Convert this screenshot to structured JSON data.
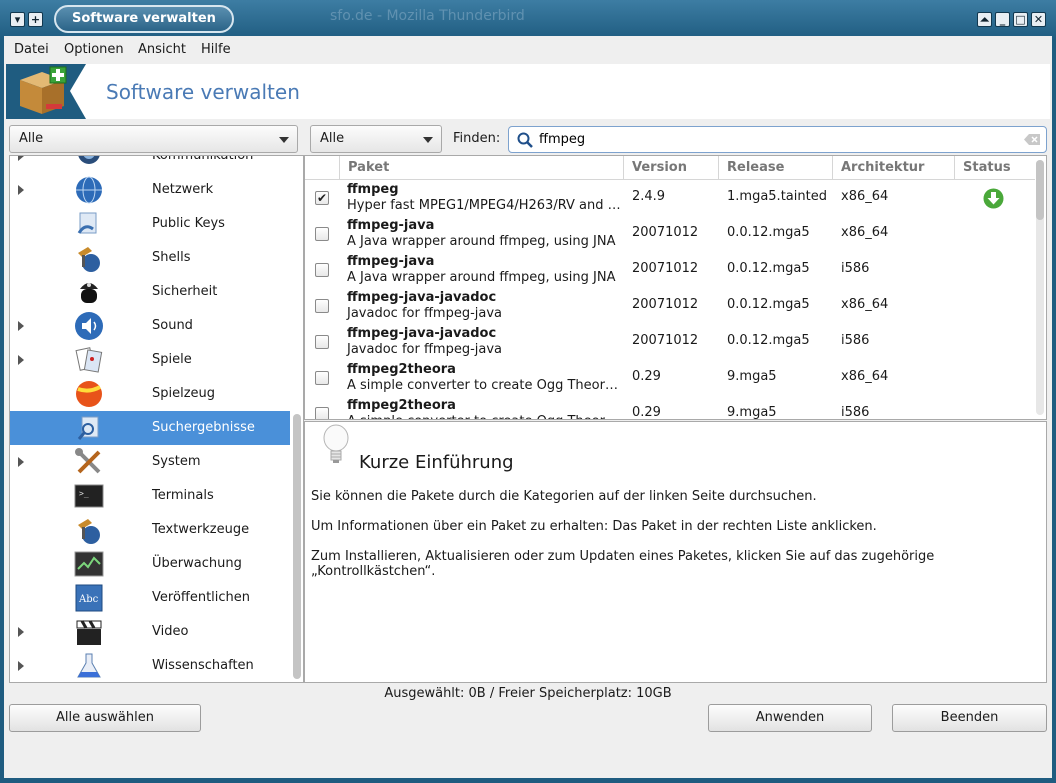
{
  "window": {
    "title": "Software verwalten",
    "ghost_title": "sfo.de - Mozilla Thunderbird"
  },
  "menubar": [
    "Datei",
    "Optionen",
    "Ansicht",
    "Hilfe"
  ],
  "banner": {
    "title": "Software verwalten"
  },
  "filters": {
    "type_filter": "Alle",
    "state_filter": "Alle",
    "find_label": "Finden:",
    "search_value": "ffmpeg"
  },
  "categories": [
    {
      "label": "Kommunikation",
      "expandable": true,
      "icon": "chat-icon"
    },
    {
      "label": "Netzwerk",
      "expandable": true,
      "icon": "globe-icon"
    },
    {
      "label": "Public Keys",
      "expandable": false,
      "icon": "key-icon"
    },
    {
      "label": "Shells",
      "expandable": false,
      "icon": "shell-icon"
    },
    {
      "label": "Sicherheit",
      "expandable": false,
      "icon": "police-icon"
    },
    {
      "label": "Sound",
      "expandable": true,
      "icon": "speaker-icon"
    },
    {
      "label": "Spiele",
      "expandable": true,
      "icon": "cards-icon"
    },
    {
      "label": "Spielzeug",
      "expandable": false,
      "icon": "ball-icon"
    },
    {
      "label": "Suchergebnisse",
      "expandable": false,
      "icon": "search-results-icon",
      "selected": true
    },
    {
      "label": "System",
      "expandable": true,
      "icon": "tools-icon"
    },
    {
      "label": "Terminals",
      "expandable": false,
      "icon": "terminal-icon"
    },
    {
      "label": "Textwerkzeuge",
      "expandable": false,
      "icon": "text-tools-icon"
    },
    {
      "label": "Überwachung",
      "expandable": false,
      "icon": "monitor-icon"
    },
    {
      "label": "Veröffentlichen",
      "expandable": false,
      "icon": "book-icon"
    },
    {
      "label": "Video",
      "expandable": true,
      "icon": "clapper-icon"
    },
    {
      "label": "Wissenschaften",
      "expandable": true,
      "icon": "flask-icon"
    }
  ],
  "table": {
    "headers": [
      "Paket",
      "Version",
      "Release",
      "Architektur",
      "Status"
    ],
    "rows": [
      {
        "name": "ffmpeg",
        "desc": "Hyper fast MPEG1/MPEG4/H263/RV and …",
        "version": "2.4.9",
        "release": "1.mga5.tainted",
        "arch": "x86_64",
        "checked": true,
        "status": "download-icon"
      },
      {
        "name": "ffmpeg-java",
        "desc": "A Java wrapper around ffmpeg, using JNA",
        "version": "20071012",
        "release": "0.0.12.mga5",
        "arch": "x86_64",
        "checked": false
      },
      {
        "name": "ffmpeg-java",
        "desc": "A Java wrapper around ffmpeg, using JNA",
        "version": "20071012",
        "release": "0.0.12.mga5",
        "arch": "i586",
        "checked": false
      },
      {
        "name": "ffmpeg-java-javadoc",
        "desc": "Javadoc for ffmpeg-java",
        "version": "20071012",
        "release": "0.0.12.mga5",
        "arch": "x86_64",
        "checked": false
      },
      {
        "name": "ffmpeg-java-javadoc",
        "desc": "Javadoc for ffmpeg-java",
        "version": "20071012",
        "release": "0.0.12.mga5",
        "arch": "i586",
        "checked": false
      },
      {
        "name": "ffmpeg2theora",
        "desc": "A simple converter to create Ogg Theor…",
        "version": "0.29",
        "release": "9.mga5",
        "arch": "x86_64",
        "checked": false
      },
      {
        "name": "ffmpeg2theora",
        "desc": "A simple converter to create Ogg Theor…",
        "version": "0.29",
        "release": "9.mga5",
        "arch": "i586",
        "checked": false
      }
    ]
  },
  "info": {
    "title": "Kurze Einführung",
    "p1": "Sie können die Pakete durch die Kategorien auf der linken Seite durchsuchen.",
    "p2": "Um Informationen über ein Paket zu erhalten: Das Paket in der rechten Liste anklicken.",
    "p3": "Zum Installieren, Aktualisieren oder zum Updaten eines Paketes, klicken Sie auf das zugehörige „Kontrollkästchen“."
  },
  "status": "Ausgewählt: 0B / Freier Speicherplatz: 10GB",
  "buttons": {
    "select_all": "Alle auswählen",
    "apply": "Anwenden",
    "quit": "Beenden"
  },
  "colors": {
    "accent": "#4a90d9",
    "titlebar": "#1f5c80"
  }
}
